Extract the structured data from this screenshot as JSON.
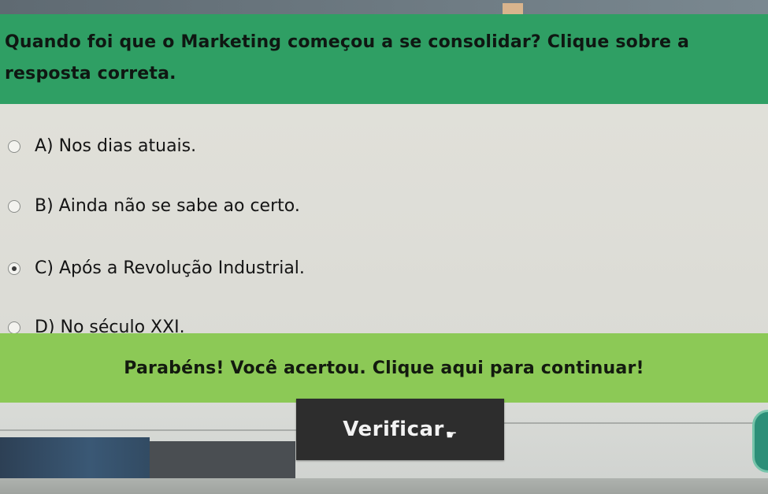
{
  "question": {
    "text": "Quando foi que o Marketing começou a se consolidar? Clique sobre a resposta correta."
  },
  "options": [
    {
      "label": "A) Nos dias atuais.",
      "selected": false
    },
    {
      "label": "B) Ainda não se sabe ao certo.",
      "selected": false
    },
    {
      "label": "C) Após a Revolução Industrial.",
      "selected": true
    },
    {
      "label": "D) No século XXI.",
      "selected": false
    }
  ],
  "feedback": {
    "text": "Parabéns! Você acertou. Clique aqui para continuar!"
  },
  "actions": {
    "verify_label": "Verificar"
  },
  "colors": {
    "question_bar": "#2f9f64",
    "feedback_bar": "#8cc956",
    "button": "#2d2d2d"
  },
  "icons": {
    "cursor": "hand-pointer-icon"
  }
}
